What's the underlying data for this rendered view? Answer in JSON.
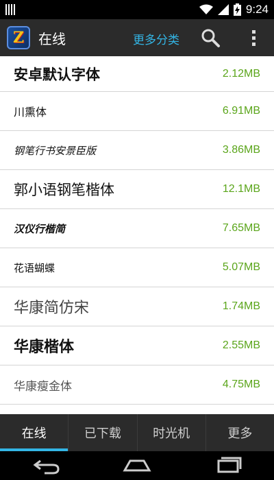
{
  "status": {
    "time": "9:24",
    "battery_glyph": "⚡"
  },
  "app": {
    "title": "在线",
    "more_categories": "更多分类",
    "logo_letter": "Z"
  },
  "fonts": [
    {
      "name": "安卓默认字体",
      "size": "2.12MB"
    },
    {
      "name": "川熏体",
      "size": "6.91MB"
    },
    {
      "name": "钢笔行书安景臣版",
      "size": "3.86MB"
    },
    {
      "name": "郭小语钢笔楷体",
      "size": "12.1MB"
    },
    {
      "name": "汉仪行楷简",
      "size": "7.65MB"
    },
    {
      "name": "花语蝴蝶",
      "size": "5.07MB"
    },
    {
      "name": "华康简仿宋",
      "size": "1.74MB"
    },
    {
      "name": "华康楷体",
      "size": "2.55MB"
    },
    {
      "name": "华康瘦金体",
      "size": "4.75MB"
    }
  ],
  "tabs": [
    {
      "label": "在线",
      "active": true
    },
    {
      "label": "已下载",
      "active": false
    },
    {
      "label": "时光机",
      "active": false
    },
    {
      "label": "更多",
      "active": false
    }
  ],
  "colors": {
    "accent": "#33b5e5",
    "size_text": "#5aa51a",
    "bar_bg": "#2b2b2b"
  }
}
